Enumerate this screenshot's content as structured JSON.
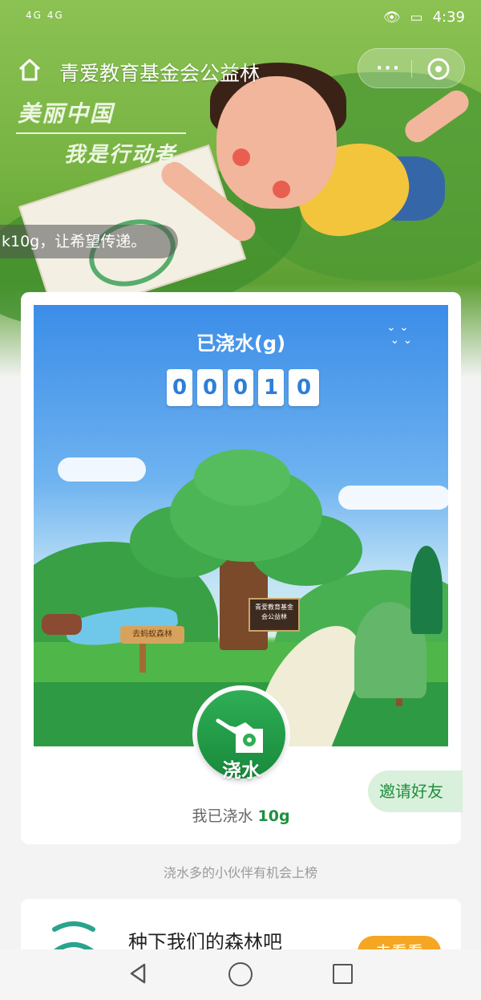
{
  "status_bar": {
    "signal": "4G 4G",
    "time": "4:39"
  },
  "header": {
    "title": "青爱教育基金会公益林",
    "more_label": "···"
  },
  "banner": {
    "slogan_line1": "美丽中国",
    "slogan_line2": "我是行动者",
    "marquee": "k10g，让希望传递。"
  },
  "watering": {
    "title": "已浇水(g)",
    "digits": [
      "0",
      "0",
      "0",
      "1",
      "0"
    ],
    "sign_text": "青爱教育基金会公益林",
    "post_text": "去蚂蚁森林",
    "button_label": "浇水",
    "watered_prefix": "我已浇水",
    "watered_amount": "10g",
    "invite_label": "邀请好友"
  },
  "hint": "浇水多的小伙伴有机会上榜",
  "next_card": {
    "title": "种下我们的森林吧",
    "button_label": "去看看"
  },
  "colors": {
    "primary_green": "#1f8f3f",
    "accent_orange": "#f5a623",
    "sky_blue": "#3b8de8"
  },
  "icons": [
    "home-icon",
    "close-icon",
    "watering-can-icon",
    "back-icon",
    "home-nav-icon",
    "recent-apps-icon"
  ]
}
